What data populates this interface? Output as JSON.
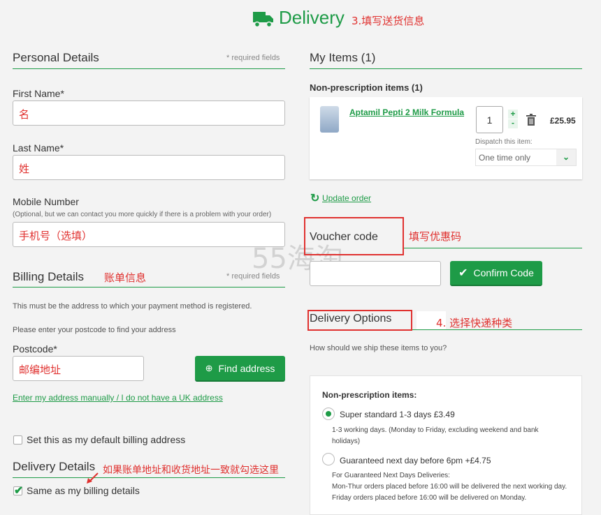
{
  "header": {
    "title": "Delivery",
    "icon": "truck-icon",
    "annotation": "3.填写送货信息"
  },
  "watermark": "55海淘",
  "personal": {
    "title": "Personal Details",
    "required": "* required fields",
    "first_name_label": "First Name*",
    "first_name_value": "名",
    "last_name_label": "Last Name*",
    "last_name_value": "姓",
    "mobile_label": "Mobile Number",
    "mobile_hint": "(Optional, but we can contact you more quickly if there is a problem with your order)",
    "mobile_value": "手机号（选填）"
  },
  "billing": {
    "title": "Billing Details",
    "annotation": "账单信息",
    "required": "* required fields",
    "note": "This must be the address to which your payment method is registered.",
    "postcode_prompt": "Please enter your postcode to find your address",
    "postcode_label": "Postcode*",
    "postcode_value": "邮编地址",
    "find_button": "Find address",
    "manual_link": "Enter my address manually / I do not have a UK address",
    "default_checkbox": "Set this as my default billing address",
    "default_checked": false
  },
  "delivery_details": {
    "title": "Delivery Details",
    "annotation": "如果账单地址和收货地址一致就勾选这里",
    "same_checkbox": "Same as my billing details",
    "same_checked": true
  },
  "items": {
    "title": "My Items (1)",
    "group_title": "Non-prescription items (1)",
    "product": {
      "name": "Aptamil Pepti 2 Milk Formula",
      "quantity": "1",
      "price": "£25.95",
      "dispatch_label": "Dispatch this item:",
      "dispatch_value": "One time only",
      "plus": "+",
      "minus": "-"
    },
    "update_link": "Update order"
  },
  "voucher": {
    "title": "Voucher code",
    "annotation": "填写优惠码",
    "input_value": "",
    "confirm_button": "Confirm Code"
  },
  "delivery_options": {
    "title": "Delivery Options",
    "annotation": "4. 选择快递种类",
    "question": "How should we ship these items to you?",
    "group_title": "Non-prescription items:",
    "options": [
      {
        "label": "Super standard 1-3 days £3.49",
        "selected": true,
        "desc": [
          "1-3 working days. (Monday to Friday, excluding weekend and bank holidays)"
        ]
      },
      {
        "label": "Guaranteed next day before 6pm +£4.75",
        "selected": false,
        "desc": [
          "For Guaranteed Next Days Deliveries:",
          "Mon-Thur orders placed before 16:00 will be delivered the next working day.",
          "Friday orders placed before 16:00 will be delivered on Monday."
        ]
      }
    ]
  },
  "colors": {
    "accent": "#1e9b47",
    "annotation": "#e0312f"
  }
}
